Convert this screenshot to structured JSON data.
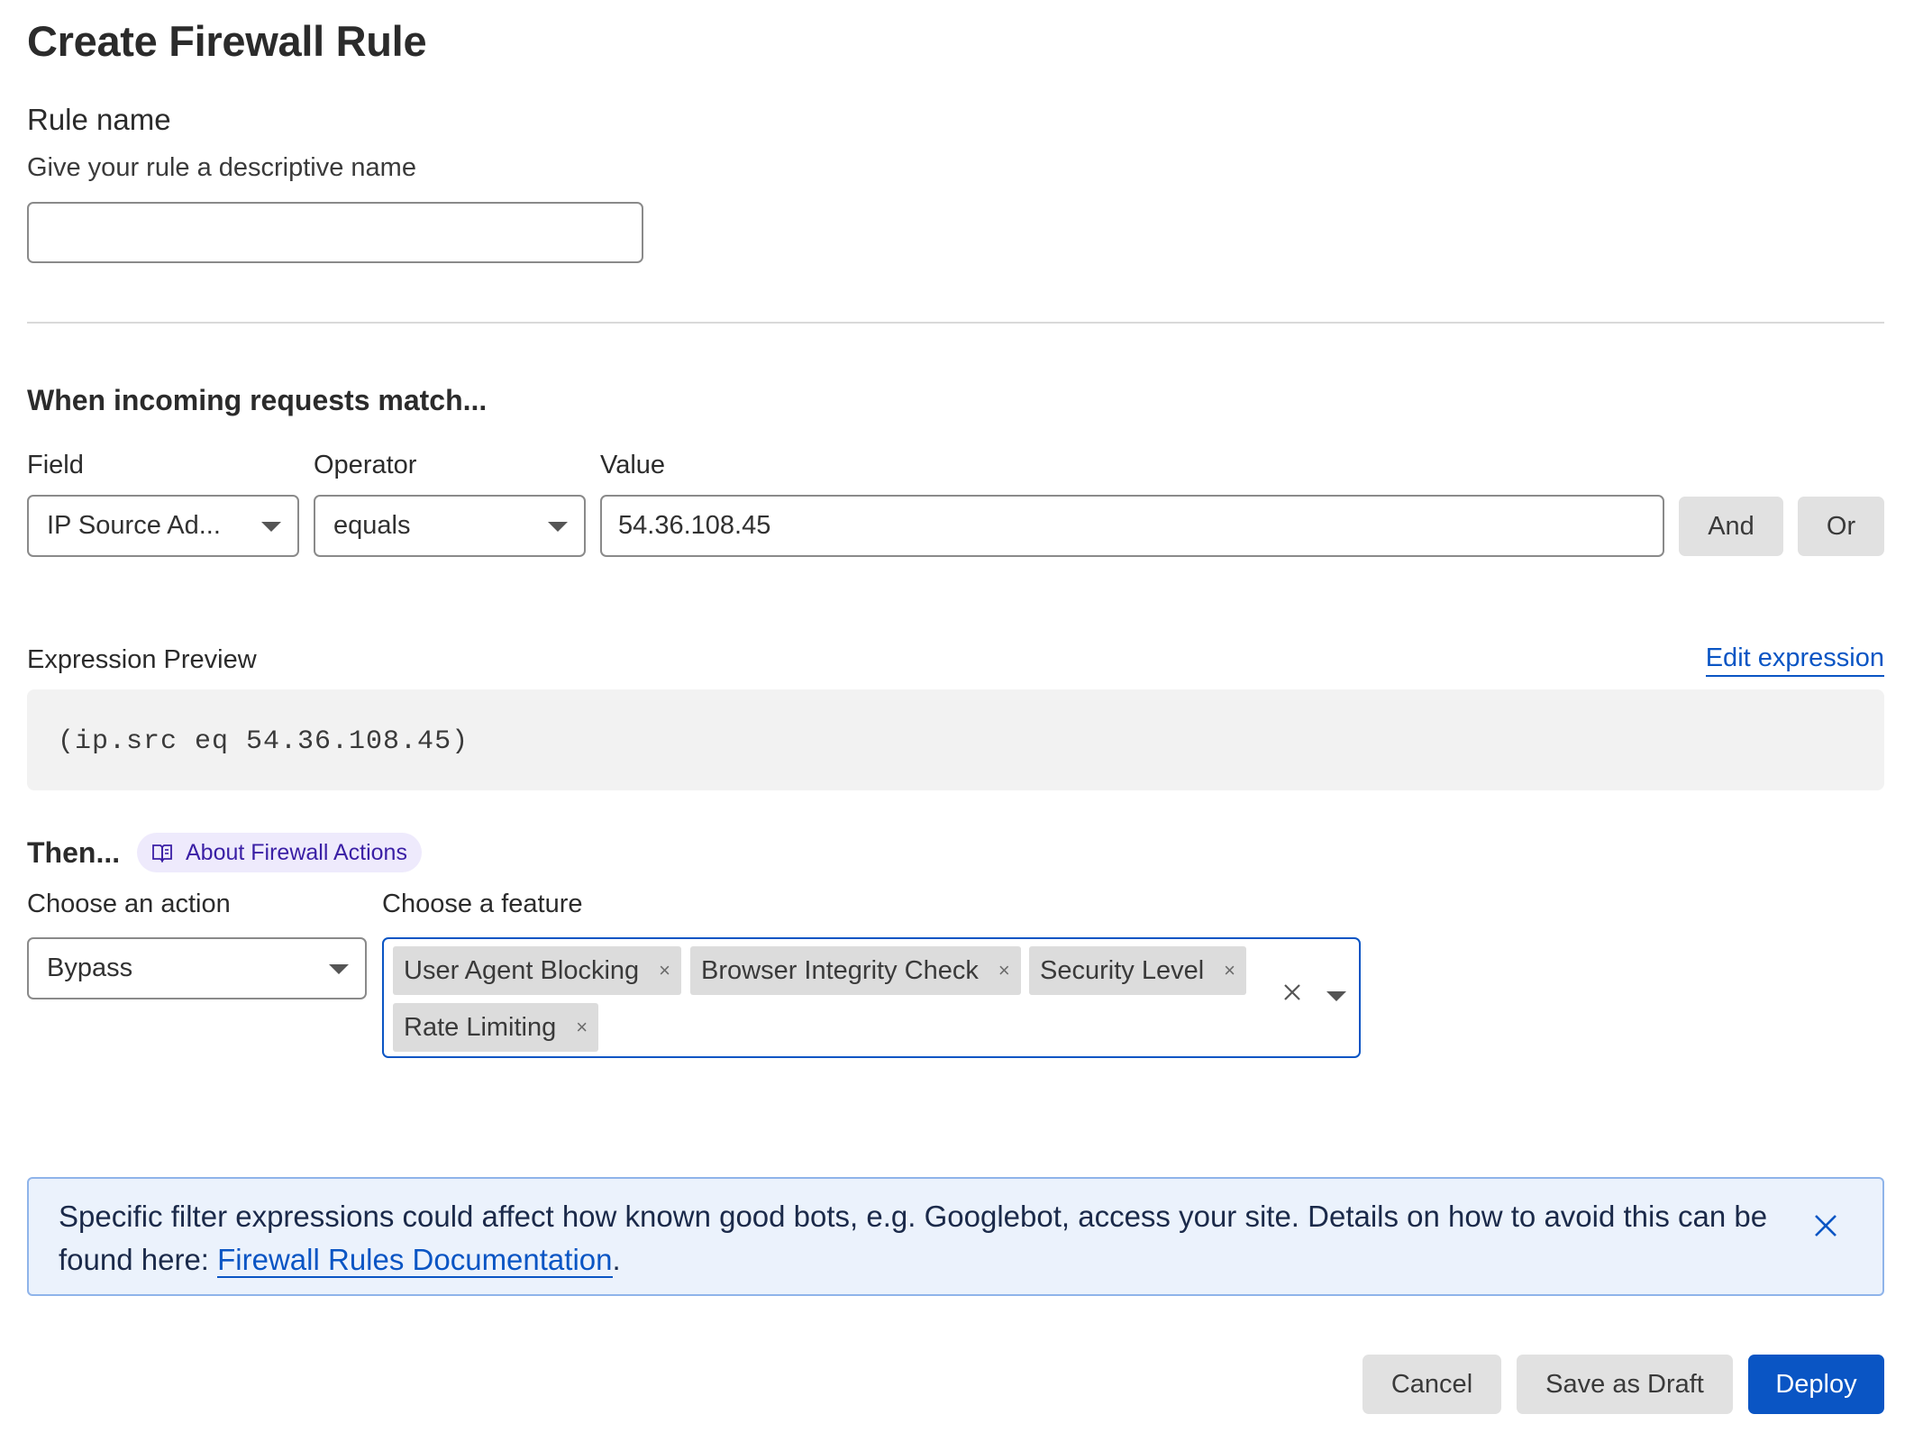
{
  "page": {
    "title": "Create Firewall Rule"
  },
  "rule_name": {
    "label": "Rule name",
    "help": "Give your rule a descriptive name",
    "value": "",
    "placeholder": ""
  },
  "match": {
    "heading": "When incoming requests match...",
    "field_label": "Field",
    "operator_label": "Operator",
    "value_label": "Value",
    "field_value": "IP Source Ad...",
    "operator_value": "equals",
    "value_value": "54.36.108.45",
    "and_label": "And",
    "or_label": "Or"
  },
  "preview": {
    "label": "Expression Preview",
    "edit_link": "Edit expression",
    "expression": "(ip.src eq 54.36.108.45)"
  },
  "then": {
    "label": "Then...",
    "about_link": "About Firewall Actions",
    "action_label": "Choose an action",
    "feature_label": "Choose a feature",
    "action_value": "Bypass",
    "features": [
      "User Agent Blocking",
      "Browser Integrity Check",
      "Security Level",
      "Rate Limiting"
    ],
    "tag_remove_glyph": "×"
  },
  "banner": {
    "text_before": "Specific filter expressions could affect how known good bots, e.g. Googlebot, access your site. Details on how to avoid this can be found here: ",
    "link_text": "Firewall Rules Documentation",
    "text_after": "."
  },
  "footer": {
    "cancel_label": "Cancel",
    "draft_label": "Save as Draft",
    "deploy_label": "Deploy"
  },
  "colors": {
    "accent": "#0a55c4",
    "banner_bg": "#ebf2fc",
    "pill_bg": "#eeeafc",
    "tag_bg": "#dcdcdc"
  },
  "icons": {
    "about": "book-icon",
    "select_caret": "caret-down-icon",
    "clear": "close-icon",
    "tag_remove": "close-icon",
    "banner_close": "close-icon"
  }
}
